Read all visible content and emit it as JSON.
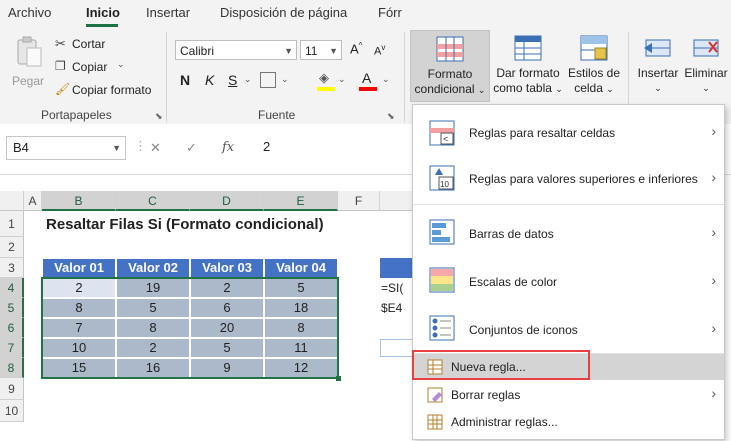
{
  "tabs": [
    "Archivo",
    "Inicio",
    "Insertar",
    "Disposición de página",
    "Fórr"
  ],
  "clipboard": {
    "paste": "Pegar",
    "cut": "Cortar",
    "copy": "Copiar",
    "format_painter": "Copiar formato",
    "group": "Portapapeles"
  },
  "font": {
    "name": "Calibri",
    "size": "11",
    "bold": "N",
    "italic": "K",
    "underline": "S",
    "fill_color": "#ffff00",
    "font_color": "#ff0000",
    "group": "Fuente"
  },
  "styles": {
    "conditional_format": [
      "Formato",
      "condicional"
    ],
    "format_as_table": [
      "Dar formato",
      "como tabla"
    ],
    "cell_styles": [
      "Estilos de",
      "celda"
    ]
  },
  "cells_group": {
    "insert": "Insertar",
    "delete": "Eliminar"
  },
  "formula_bar": {
    "name_box": "B4",
    "cancel": "✕",
    "enter": "✓",
    "fx": "fx",
    "value": "2"
  },
  "grid": {
    "columns": [
      "A",
      "B",
      "C",
      "D",
      "E",
      "F"
    ],
    "rows": [
      "1",
      "2",
      "3",
      "4",
      "5",
      "6",
      "7",
      "8",
      "9",
      "10"
    ],
    "title": "Resaltar Filas Si (Formato condicional)",
    "headers": [
      "Valor 01",
      "Valor 02",
      "Valor 03",
      "Valor 04"
    ],
    "data": [
      [
        "2",
        "19",
        "2",
        "5"
      ],
      [
        "8",
        "5",
        "6",
        "18"
      ],
      [
        "7",
        "8",
        "20",
        "8"
      ],
      [
        "10",
        "2",
        "5",
        "11"
      ],
      [
        "15",
        "16",
        "9",
        "12"
      ]
    ],
    "side_text": [
      "=SI(",
      "$E4"
    ]
  },
  "menu": {
    "items": [
      "Reglas para resaltar celdas",
      "Reglas para valores superiores e inferiores",
      "Barras de datos",
      "Escalas de color",
      "Conjuntos de iconos",
      "Nueva regla...",
      "Borrar reglas",
      "Administrar reglas..."
    ]
  },
  "colors": {
    "header_fill": "#4472c4",
    "data_fill": "#acb9ca",
    "accent": "#217346",
    "highlight_border": "#e84040"
  }
}
